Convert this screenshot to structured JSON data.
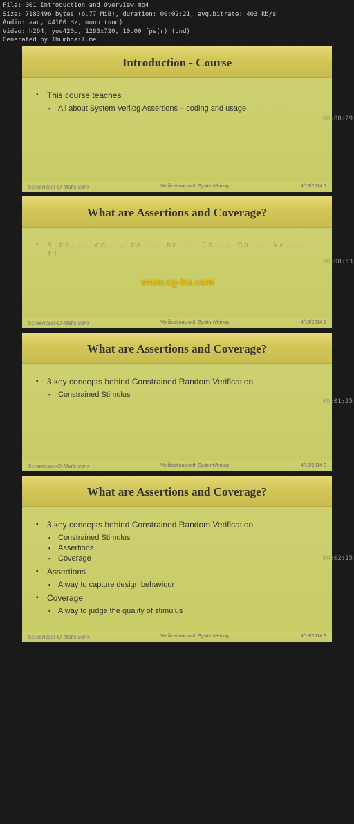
{
  "meta": {
    "filename": "File: 001 Introduction and Overview.mp4",
    "size": "Size: 7183496 bytes (6.77 MiB), duration: 00:02:21, avg.bitrate: 403 kb/s",
    "audio": "Audio: aac, 44100 Hz, mono (und)",
    "video": "Video: h264, yuv420p, 1280x720, 10.00 fps(r) (und)",
    "generated": "Generated by Thumbnail.me"
  },
  "slides": [
    {
      "id": "slide1",
      "title": "Introduction - Course",
      "bullets": [
        {
          "text": "This course teaches",
          "sub": [
            {
              "text": "All about System Verilog Assertions – coding and usage",
              "sub": []
            }
          ]
        }
      ],
      "footer_left": "Verifications with SystemVerilog",
      "footer_right": "4/18/2014   1",
      "timestamp": "00:00:29",
      "watermark": null
    },
    {
      "id": "slide2",
      "title": "What are Assertions and Coverage?",
      "bullets_blurred": "3 ke... co... ce... be... Co... ns... Ra... nd... Ve... fi...",
      "footer_left": "Verifications with SystemVerilog",
      "footer_right": "4/18/2014   2",
      "timestamp": "00:00:53",
      "watermark": "www.cg-ku.com"
    },
    {
      "id": "slide3",
      "title": "What are Assertions and Coverage?",
      "bullets": [
        {
          "text": "3 key concepts behind Constrained Random Verification",
          "sub": [
            {
              "text": "Constrained Stimulus",
              "sub": []
            }
          ]
        }
      ],
      "footer_left": "Verifications with SystemVerilog",
      "footer_right": "4/18/2014   3",
      "timestamp": "00:01:25",
      "watermark": null
    },
    {
      "id": "slide4",
      "title": "What are Assertions and Coverage?",
      "bullets": [
        {
          "text": "3 key concepts behind Constrained Random Verification",
          "sub": [
            {
              "text": "Constrained Stimulus",
              "sub": []
            },
            {
              "text": "Assertions",
              "sub": []
            },
            {
              "text": "Coverage",
              "sub": []
            }
          ]
        },
        {
          "text": "Assertions",
          "sub": [
            {
              "text": "A way to capture design behaviour",
              "sub": []
            }
          ]
        },
        {
          "text": "Coverage",
          "sub": [
            {
              "text": "A way to judge the quality of stimulus",
              "sub": []
            }
          ]
        }
      ],
      "footer_left": "Verifications with SystemVerilog",
      "footer_right": "4/18/2014   3",
      "timestamp": "00:02:15",
      "watermark": null
    }
  ]
}
